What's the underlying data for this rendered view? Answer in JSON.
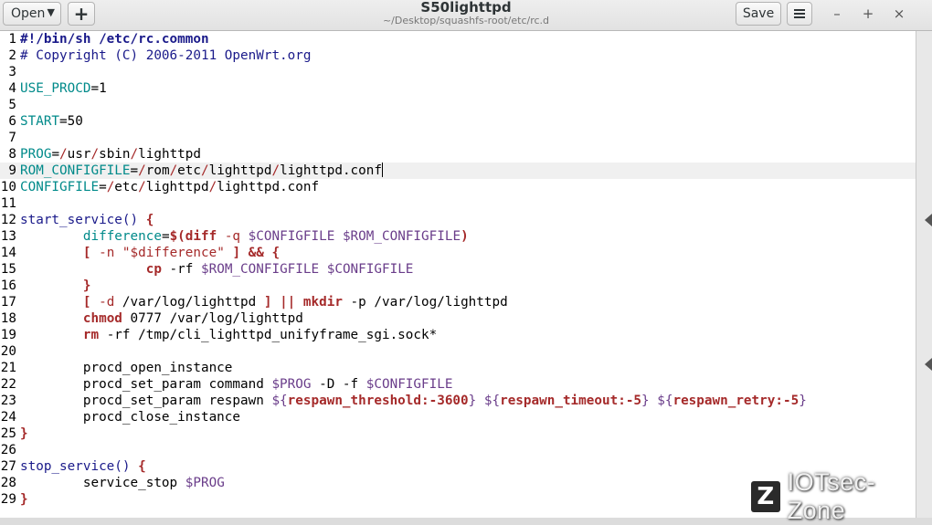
{
  "toolbar": {
    "open_label": "Open",
    "new_tab_label": "+",
    "save_label": "Save"
  },
  "window": {
    "title": "S50lighttpd",
    "path": "~/Desktop/squashfs-root/etc/rc.d",
    "controls": [
      "minimize-icon",
      "maximize-icon",
      "close-icon"
    ]
  },
  "editor": {
    "current_line": 9,
    "lines": [
      {
        "n": "1",
        "tokens": [
          [
            "shebang",
            "#!/bin/sh /etc/rc.common"
          ]
        ]
      },
      {
        "n": "2",
        "tokens": [
          [
            "comment",
            "# Copyright (C) 2006-2011 OpenWrt.org"
          ]
        ]
      },
      {
        "n": "3",
        "tokens": []
      },
      {
        "n": "4",
        "tokens": [
          [
            "var",
            "USE_PROCD"
          ],
          [
            "dflt",
            "=1"
          ]
        ]
      },
      {
        "n": "5",
        "tokens": []
      },
      {
        "n": "6",
        "tokens": [
          [
            "var",
            "START"
          ],
          [
            "dflt",
            "=50"
          ]
        ]
      },
      {
        "n": "7",
        "tokens": []
      },
      {
        "n": "8",
        "tokens": [
          [
            "var",
            "PROG"
          ],
          [
            "dflt",
            "="
          ],
          [
            "op",
            "/"
          ],
          [
            "dflt",
            "usr"
          ],
          [
            "op",
            "/"
          ],
          [
            "dflt",
            "sbin"
          ],
          [
            "op",
            "/"
          ],
          [
            "dflt",
            "lighttpd"
          ]
        ]
      },
      {
        "n": "9",
        "tokens": [
          [
            "var",
            "ROM_CONFIGFILE"
          ],
          [
            "dflt",
            "="
          ],
          [
            "op",
            "/"
          ],
          [
            "dflt",
            "rom"
          ],
          [
            "op",
            "/"
          ],
          [
            "dflt",
            "etc"
          ],
          [
            "op",
            "/"
          ],
          [
            "dflt",
            "lighttpd"
          ],
          [
            "op",
            "/"
          ],
          [
            "dflt",
            "lighttpd.conf"
          ]
        ]
      },
      {
        "n": "10",
        "tokens": [
          [
            "var",
            "CONFIGFILE"
          ],
          [
            "dflt",
            "="
          ],
          [
            "op",
            "/"
          ],
          [
            "dflt",
            "etc"
          ],
          [
            "op",
            "/"
          ],
          [
            "dflt",
            "lighttpd"
          ],
          [
            "op",
            "/"
          ],
          [
            "dflt",
            "lighttpd.conf"
          ]
        ]
      },
      {
        "n": "11",
        "tokens": []
      },
      {
        "n": "12",
        "tokens": [
          [
            "func",
            "start_service() "
          ],
          [
            "brk",
            "{"
          ]
        ]
      },
      {
        "n": "13",
        "tokens": [
          [
            "dflt",
            "        "
          ],
          [
            "var",
            "difference"
          ],
          [
            "dflt",
            "="
          ],
          [
            "bold",
            "$(diff"
          ],
          [
            "dflt",
            " "
          ],
          [
            "opt",
            "-q"
          ],
          [
            "dflt",
            " "
          ],
          [
            "varref",
            "$CONFIGFILE"
          ],
          [
            "dflt",
            " "
          ],
          [
            "varref",
            "$ROM_CONFIGFILE"
          ],
          [
            "bold",
            ")"
          ]
        ]
      },
      {
        "n": "14",
        "tokens": [
          [
            "dflt",
            "        "
          ],
          [
            "brk",
            "["
          ],
          [
            "dflt",
            " "
          ],
          [
            "opt",
            "-n"
          ],
          [
            "dflt",
            " "
          ],
          [
            "str",
            "\"$difference\""
          ],
          [
            "dflt",
            " "
          ],
          [
            "brk",
            "]"
          ],
          [
            "dflt",
            " "
          ],
          [
            "bold",
            "&&"
          ],
          [
            "dflt",
            " "
          ],
          [
            "brk",
            "{"
          ]
        ]
      },
      {
        "n": "15",
        "tokens": [
          [
            "dflt",
            "                "
          ],
          [
            "cmd",
            "cp"
          ],
          [
            "dflt",
            " -rf "
          ],
          [
            "varref",
            "$ROM_CONFIGFILE"
          ],
          [
            "dflt",
            " "
          ],
          [
            "varref",
            "$CONFIGFILE"
          ]
        ]
      },
      {
        "n": "16",
        "tokens": [
          [
            "dflt",
            "        "
          ],
          [
            "brk",
            "}"
          ]
        ]
      },
      {
        "n": "17",
        "tokens": [
          [
            "dflt",
            "        "
          ],
          [
            "brk",
            "["
          ],
          [
            "dflt",
            " "
          ],
          [
            "opt",
            "-d"
          ],
          [
            "dflt",
            " /var/log/lighttpd "
          ],
          [
            "brk",
            "]"
          ],
          [
            "dflt",
            " "
          ],
          [
            "bold",
            "||"
          ],
          [
            "dflt",
            " "
          ],
          [
            "cmd",
            "mkdir"
          ],
          [
            "dflt",
            " -p /var/log/lighttpd"
          ]
        ]
      },
      {
        "n": "18",
        "tokens": [
          [
            "dflt",
            "        "
          ],
          [
            "cmd",
            "chmod"
          ],
          [
            "dflt",
            " 0777 /var/log/lighttpd"
          ]
        ]
      },
      {
        "n": "19",
        "tokens": [
          [
            "dflt",
            "        "
          ],
          [
            "cmd",
            "rm"
          ],
          [
            "dflt",
            " -rf /tmp/cli_lighttpd_unifyframe_sgi.sock*"
          ]
        ]
      },
      {
        "n": "20",
        "tokens": []
      },
      {
        "n": "21",
        "tokens": [
          [
            "dflt",
            "        procd_open_instance"
          ]
        ]
      },
      {
        "n": "22",
        "tokens": [
          [
            "dflt",
            "        procd_set_param command "
          ],
          [
            "varref",
            "$PROG"
          ],
          [
            "dflt",
            " -D -f "
          ],
          [
            "varref",
            "$CONFIGFILE"
          ]
        ]
      },
      {
        "n": "23",
        "tokens": [
          [
            "dflt",
            "        procd_set_param respawn "
          ],
          [
            "varref",
            "${"
          ],
          [
            "bold",
            "respawn_threshold:-3600"
          ],
          [
            "varref",
            "}"
          ],
          [
            "dflt",
            " "
          ],
          [
            "varref",
            "${"
          ],
          [
            "bold",
            "respawn_timeout:-5"
          ],
          [
            "varref",
            "}"
          ],
          [
            "dflt",
            " "
          ],
          [
            "varref",
            "${"
          ],
          [
            "bold",
            "respawn_retry:-5"
          ],
          [
            "varref",
            "}"
          ]
        ]
      },
      {
        "n": "24",
        "tokens": [
          [
            "dflt",
            "        procd_close_instance"
          ]
        ]
      },
      {
        "n": "25",
        "tokens": [
          [
            "brk",
            "}"
          ]
        ]
      },
      {
        "n": "26",
        "tokens": []
      },
      {
        "n": "27",
        "tokens": [
          [
            "func",
            "stop_service() "
          ],
          [
            "brk",
            "{"
          ]
        ]
      },
      {
        "n": "28",
        "tokens": [
          [
            "dflt",
            "        service_stop "
          ],
          [
            "varref",
            "$PROG"
          ]
        ]
      },
      {
        "n": "29",
        "tokens": [
          [
            "brk",
            "}"
          ]
        ]
      }
    ]
  },
  "watermark": {
    "logo_letter": "Z",
    "text": "IOTsec-Zone"
  },
  "colors": {
    "keyword": "#a52a2a",
    "variable": "#008a8a",
    "comment": "#1a1a8a",
    "current_line_bg": "#f0f0f0"
  }
}
